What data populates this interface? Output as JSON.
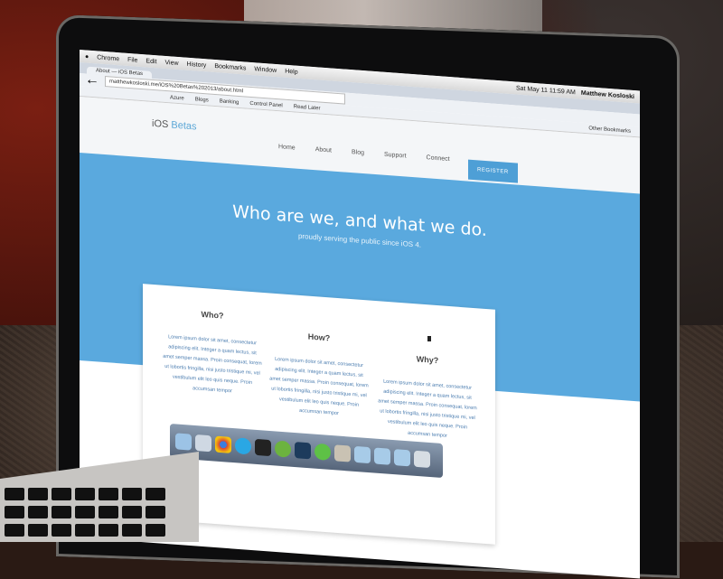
{
  "menubar": {
    "apple": "",
    "items": [
      "Chrome",
      "File",
      "Edit",
      "View",
      "History",
      "Bookmarks",
      "Window",
      "Help"
    ],
    "clock": "Sat May 11  11:59 AM",
    "user": "Matthew Kosloski"
  },
  "browser": {
    "tab_title": "About — iOS Betas",
    "url": "matthewkosloski.me/iOS%20Betas%202013/about.html",
    "bookmarks": [
      "Azure",
      "Blogs",
      "Banking",
      "Control Panel",
      "Read Later"
    ],
    "other_bookmarks": "Other Bookmarks"
  },
  "site": {
    "logo_prefix": "iOS",
    "logo_suffix": "Betas",
    "nav": [
      "Home",
      "About",
      "Blog",
      "Support",
      "Connect"
    ],
    "register": "REGISTER",
    "hero_title": "Who are we, and what we do.",
    "hero_subtitle": "proudly serving the public since iOS 4.",
    "columns": [
      {
        "heading": "Who?",
        "body": "Lorem ipsum dolor sit amet, consectetur adipiscing elit. Integer a quam lectus, sit amet semper massa. Proin consequat, lorem ut lobortis fringilla, nisi justo tristique mi, vel vestibulum elit leo quis neque. Proin accumsan tempor"
      },
      {
        "heading": "How?",
        "body": "Lorem ipsum dolor sit amet, consectetur adipiscing elit. Integer a quam lectus, sit amet semper massa. Proin consequat, lorem ut lobortis fringilla, nisi justo tristique mi, vel vestibulum elit leo quis neque. Proin accumsan tempor"
      },
      {
        "heading": "Why?",
        "body": "Lorem ipsum dolor sit amet, consectetur adipiscing elit. Integer a quam lectus, sit amet semper massa. Proin consequat, lorem ut lobortis fringilla, nisi justo tristique mi, vel vestibulum elit leo quis neque. Proin accumsan tempor"
      }
    ]
  },
  "colors": {
    "hero_blue": "#5aa9de",
    "accent": "#4e9fd6",
    "logo_blue": "#5aa6d6"
  },
  "dock_icons": [
    "finder-icon",
    "app-icon",
    "chrome-icon",
    "skype-icon",
    "terminal-icon",
    "spotify-icon",
    "photoshop-icon",
    "messages-icon",
    "automator-icon",
    "folder-icon",
    "folder-icon",
    "folder-icon",
    "trash-icon"
  ]
}
